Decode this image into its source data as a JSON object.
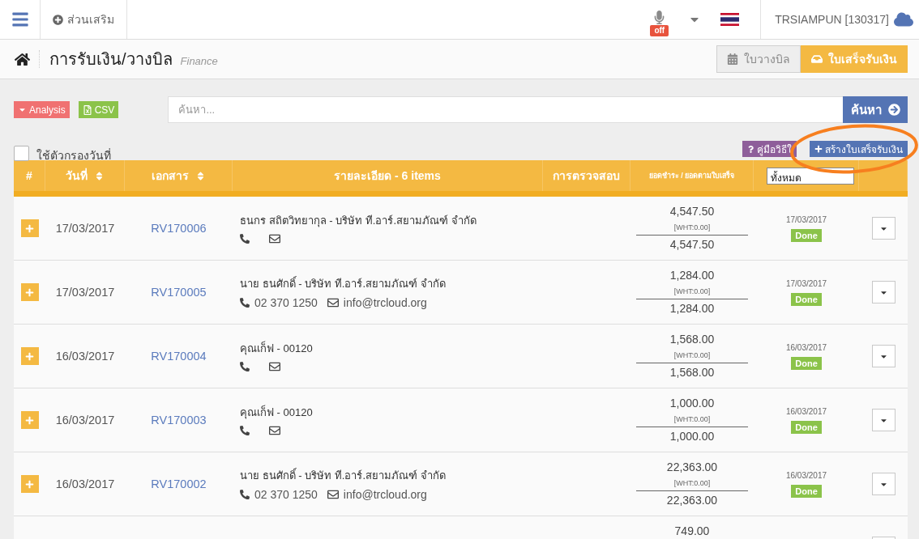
{
  "topbar": {
    "addons_label": "ส่วนเสริม",
    "mic_badge": "off",
    "user": "TRSIAMPUN [130317]"
  },
  "page_header": {
    "title": "การรับเงิน/วางบิล",
    "subtitle": "Finance",
    "tabs": [
      {
        "label": "ใบวางบิล",
        "kind": "calendar",
        "selected": false
      },
      {
        "label": "ใบเสร็จรับเงิน",
        "kind": "inbox",
        "selected": true
      }
    ]
  },
  "toolbar": {
    "buttons": [
      {
        "kind": "analysis",
        "label": "Analysis"
      },
      {
        "kind": "csv",
        "label": "CSV"
      }
    ],
    "search": {
      "placeholder": "ค้นหา...",
      "button": "ค้นหา"
    }
  },
  "date_filter": {
    "label": "ใช้ตัวกรองวันที่",
    "checked": false
  },
  "actions": [
    {
      "kind": "guide",
      "label": "คู่มือวิธีใ"
    },
    {
      "kind": "create",
      "label": "สร้างใบเสร็จรับเงิน"
    }
  ],
  "annotation": {
    "kind": "ellipse"
  },
  "table": {
    "columns": [
      {
        "label": "#",
        "sortable": false
      },
      {
        "label": "วันที่",
        "sortable": true
      },
      {
        "label": "เอกสาร",
        "sortable": true
      },
      {
        "label": "รายละเอียด - 6 items",
        "sortable": false
      },
      {
        "label": "การตรวจสอบ",
        "sortable": false
      },
      {
        "label": "ยอดชำระ / ยอดตามใบเสร็จ",
        "sortable": false
      }
    ],
    "status_filter": {
      "value": "ทั้งหมด"
    },
    "rows": [
      {
        "date": "17/03/2017",
        "document": "RV170006",
        "name": "ธนกร สถิตวิทยากุล - บริษัท ที.อาร์.สยามภัณฑ์ จำกัด",
        "paid": "4,547.50",
        "wht": "[WHT:0.00]",
        "total": "4,547.50",
        "check_date": "17/03/2017",
        "status": "Done"
      },
      {
        "date": "17/03/2017",
        "document": "RV170005",
        "name": "นาย ธนศักดิ์ - บริษัท ที.อาร์.สยามภัณฑ์ จำกัด",
        "phone": "02 370 1250",
        "email": "info@trcloud.org",
        "paid": "1,284.00",
        "wht": "[WHT:0.00]",
        "total": "1,284.00",
        "check_date": "17/03/2017",
        "status": "Done"
      },
      {
        "date": "16/03/2017",
        "document": "RV170004",
        "name": "คุณเก็ฟ - 00120",
        "paid": "1,568.00",
        "wht": "[WHT:0.00]",
        "total": "1,568.00",
        "check_date": "16/03/2017",
        "status": "Done"
      },
      {
        "date": "16/03/2017",
        "document": "RV170003",
        "name": "คุณเก็ฟ - 00120",
        "paid": "1,000.00",
        "wht": "[WHT:0.00]",
        "total": "1,000.00",
        "check_date": "16/03/2017",
        "status": "Done"
      },
      {
        "date": "16/03/2017",
        "document": "RV170002",
        "name": "นาย ธนศักดิ์ - บริษัท ที.อาร์.สยามภัณฑ์ จำกัด",
        "phone": "02 370 1250",
        "email": "info@trcloud.org",
        "paid": "22,363.00",
        "wht": "[WHT:0.00]",
        "total": "22,363.00",
        "check_date": "16/03/2017",
        "status": "Done"
      },
      {
        "paid": "749.00"
      }
    ]
  }
}
